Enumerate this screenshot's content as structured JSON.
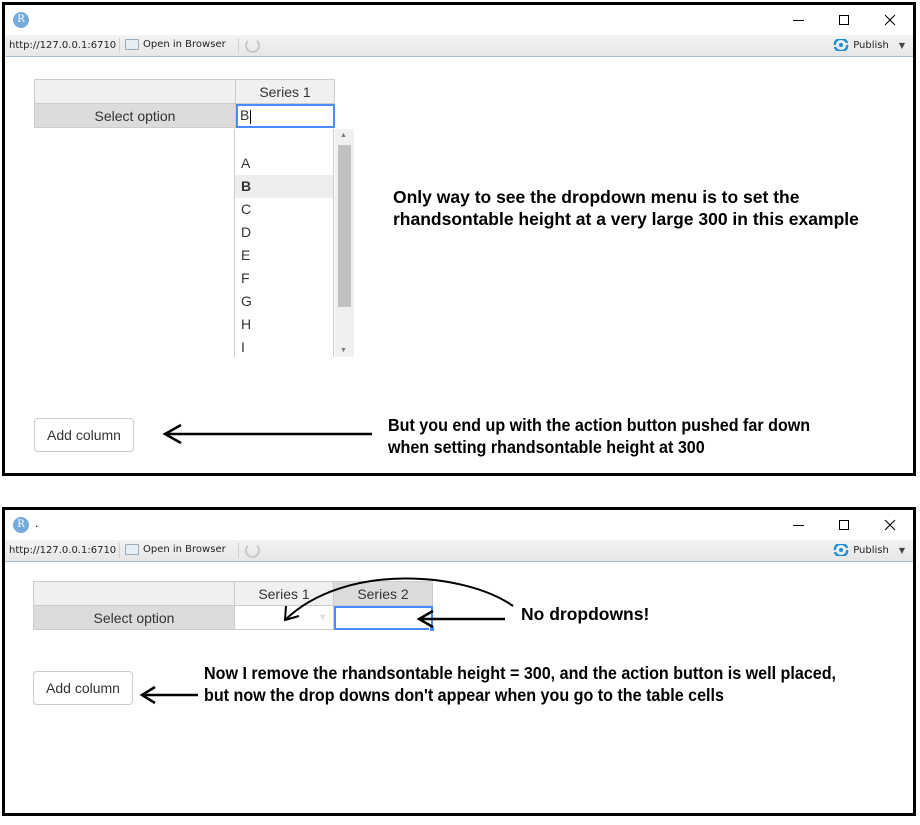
{
  "top_window": {
    "title": "",
    "window_controls": {
      "minimize": "minimize",
      "maximize": "maximize",
      "close": "close"
    },
    "toolbar": {
      "url": "http://127.0.0.1:6710",
      "open_in_browser": "Open in Browser",
      "publish": "Publish"
    },
    "table": {
      "columns": [
        "Series 1"
      ],
      "row_header": "Select option",
      "editor_value": "B"
    },
    "dropdown": {
      "items": [
        "",
        "A",
        "B",
        "C",
        "D",
        "E",
        "F",
        "G",
        "H",
        "I"
      ],
      "highlighted": "B"
    },
    "add_column_button": "Add column",
    "annotation_1": "Only way to see the dropdown menu is to set the rhandsontable height at a very large 300 in this example",
    "annotation_2": "But you end up with the action button pushed far down when setting rhandsontable height at 300"
  },
  "bottom_window": {
    "title": ".",
    "toolbar": {
      "url": "http://127.0.0.1:6710",
      "open_in_browser": "Open in Browser",
      "publish": "Publish"
    },
    "table": {
      "columns": [
        "Series 1",
        "Series 2"
      ],
      "row_header": "Select option",
      "cells": [
        "",
        ""
      ]
    },
    "add_column_button": "Add column",
    "annotation_1": "No dropdowns!",
    "annotation_2": "Now I remove the rhandsontable height = 300, and the action button is well placed, but now the drop downs don't appear when you go to the table cells"
  },
  "colors": {
    "selection": "#4b89ff",
    "r_logo": "#75aadb",
    "publish_icon": "#1b8fd6"
  }
}
